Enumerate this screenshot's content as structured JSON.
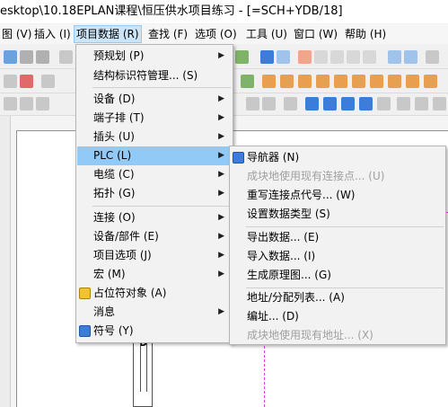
{
  "title": "esktop\\10.18EPLAN课程\\恒压供水项目练习 - [=SCH+YDB/18]",
  "menubar": [
    {
      "label": "图 (V)"
    },
    {
      "label": "插入 (I)"
    },
    {
      "label": "项目数据 (R)"
    },
    {
      "label": "查找 (F)"
    },
    {
      "label": "选项 (O)"
    },
    {
      "label": "工具 (U)"
    },
    {
      "label": "窗口 (W)"
    },
    {
      "label": "帮助 (H)"
    }
  ],
  "project_data_menu": [
    {
      "label": "预规划 (P)",
      "submenu": true
    },
    {
      "label": "结构标识符管理... (S)",
      "submenu": false
    },
    {
      "label": "设备 (D)",
      "submenu": true
    },
    {
      "label": "端子排 (T)",
      "submenu": true
    },
    {
      "label": "插头 (U)",
      "submenu": true
    },
    {
      "label": "PLC (L)",
      "submenu": true,
      "highlighted": true
    },
    {
      "label": "电缆 (C)",
      "submenu": true
    },
    {
      "label": "拓扑 (G)",
      "submenu": true
    },
    {
      "label": "连接 (O)",
      "submenu": true
    },
    {
      "label": "设备/部件 (E)",
      "submenu": true
    },
    {
      "label": "项目选项 (J)",
      "submenu": true
    },
    {
      "label": "宏 (M)",
      "submenu": true
    },
    {
      "label": "占位符对象 (A)",
      "submenu": false,
      "icon": "placeholder-object-icon"
    },
    {
      "label": "消息",
      "submenu": true
    },
    {
      "label": "符号 (Y)",
      "submenu": false,
      "icon": "symbol-icon"
    }
  ],
  "plc_submenu": [
    {
      "label": "导航器 (N)",
      "disabled": false,
      "icon": "navigator-icon"
    },
    {
      "label": "成块地使用现有连接点... (U)",
      "disabled": true
    },
    {
      "label": "重写连接点代号... (W)",
      "disabled": false
    },
    {
      "label": "设置数据类型 (S)",
      "disabled": false
    },
    {
      "label": "导出数据... (E)",
      "disabled": false
    },
    {
      "label": "导入数据... (I)",
      "disabled": false
    },
    {
      "label": "生成原理图... (G)",
      "disabled": false
    },
    {
      "label": "地址/分配列表... (A)",
      "disabled": false
    },
    {
      "label": "编址... (D)",
      "disabled": false
    },
    {
      "label": "成块地使用现有地址... (X)",
      "disabled": true
    }
  ],
  "sheet": {
    "frame_label": "D"
  },
  "colors": {
    "highlight": "#91c9f7",
    "menu_bg": "#f2f2f2",
    "disabled_text": "#a0a0a0",
    "dash": "#e040e0"
  }
}
